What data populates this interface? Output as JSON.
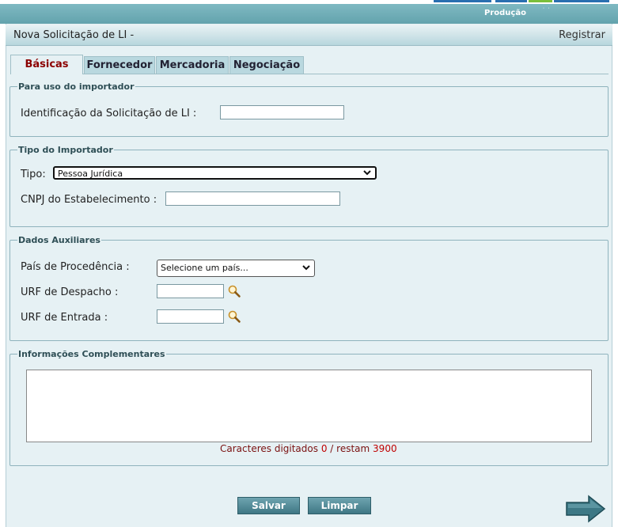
{
  "topbar": {
    "environment": "Produção",
    "dots": "˙ ˙"
  },
  "header": {
    "title": "Nova Solicitação de LI -",
    "action": "Registrar"
  },
  "tabs": [
    {
      "label": "Básicas",
      "active": true
    },
    {
      "label": "Fornecedor",
      "active": false
    },
    {
      "label": "Mercadoria",
      "active": false
    },
    {
      "label": "Negociação",
      "active": false
    }
  ],
  "importer_use": {
    "legend": "Para uso do importador",
    "id_label": "Identificação da Solicitação de LI :",
    "id_value": ""
  },
  "importer_type": {
    "legend": "Tipo do Importador",
    "type_label": "Tipo:",
    "type_value": "Pessoa Jurídica",
    "cnpj_label": "CNPJ do Estabelecimento :",
    "cnpj_value": ""
  },
  "aux_data": {
    "legend": "Dados Auxiliares",
    "country_label": "País de Procedência :",
    "country_value": "Selecione um país...",
    "urf_dispatch_label": "URF de Despacho :",
    "urf_dispatch_value": "",
    "urf_entry_label": "URF de Entrada :",
    "urf_entry_value": ""
  },
  "complementary": {
    "legend": "Informações Complementares",
    "text": "",
    "counter_prefix": "Caracteres digitados",
    "typed": "0",
    "counter_mid": "/ restam",
    "remaining": "3900"
  },
  "buttons": {
    "save": "Salvar",
    "clear": "Limpar"
  },
  "icons": {
    "search": "magnifier-icon",
    "next": "next-arrow-icon",
    "select": "chevron-down-icon"
  },
  "colors": {
    "theme": "#63a3ad",
    "panel": "#e6f1f4",
    "active_tab_text": "#8b0000",
    "counter_value": "#c00000"
  }
}
